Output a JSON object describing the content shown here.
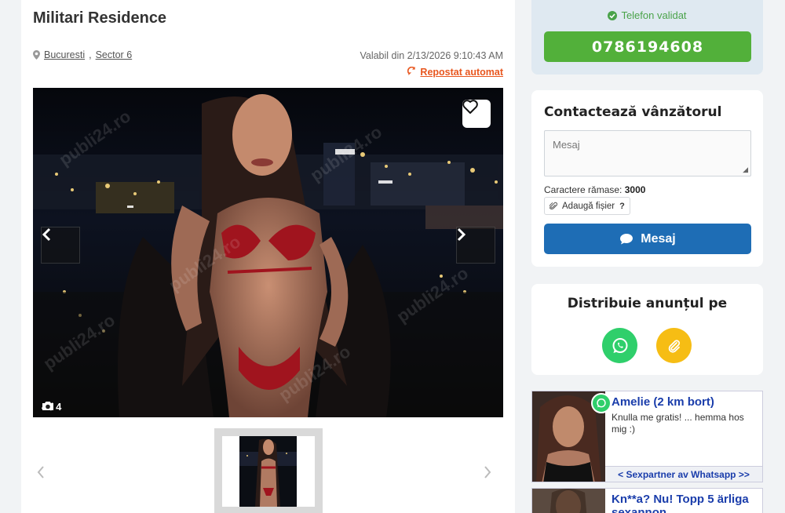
{
  "listing": {
    "title": "Militari Residence",
    "location_city": "Bucuresti",
    "location_sector": "Sector 6",
    "valid_since": "Valabil din 2/13/2026 9:10:43 AM",
    "repost_label": "Repostat automat",
    "photo_counter": "4 / 4",
    "watermark": "publi24.ro"
  },
  "phone": {
    "validated_label": "Telefon validat",
    "number": "0786194608",
    "colors": {
      "button": "#52b03a",
      "validated": "#4aa34a"
    }
  },
  "contact": {
    "title": "Contactează vânzătorul",
    "message_placeholder": "Mesaj",
    "chars_label": "Caractere rămase:",
    "chars_value": "3000",
    "attach_label": "Adaugă fișier",
    "attach_help": "?",
    "send_label": "Mesaj",
    "colors": {
      "button": "#1e6db5"
    }
  },
  "share": {
    "title": "Distribuie anunțul pe",
    "icons": [
      "whatsapp-icon",
      "link-icon"
    ]
  },
  "ads": [
    {
      "title": "Amelie (2 km bort)",
      "text": "Knulla me gratis! ... hemma hos mig :)",
      "link": "< Sexpartner av Whatsapp >>"
    },
    {
      "title": "Kn**a? Nu! Topp 5 ärliga sexannon"
    }
  ]
}
